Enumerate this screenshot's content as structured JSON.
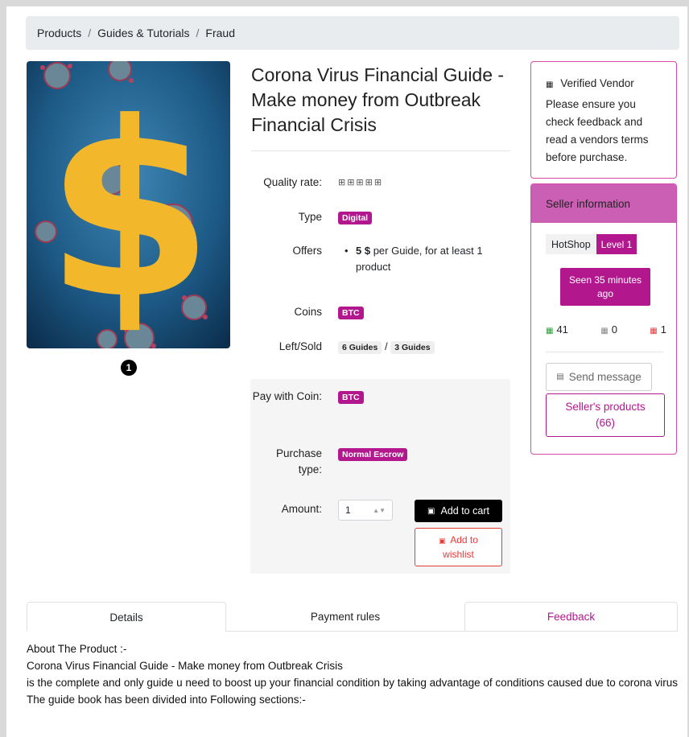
{
  "breadcrumb": {
    "items": [
      "Products",
      "Guides & Tutorials",
      "Fraud"
    ],
    "separator": "/"
  },
  "image": {
    "glyph": "$",
    "indicator": "1"
  },
  "product": {
    "title": "Corona Virus Financial Guide - Make money from Outbreak Financial Crisis",
    "quality_label": "Quality rate:",
    "quality_stars": "⊞⊞⊞⊞⊞",
    "type_label": "Type",
    "type_value": "Digital",
    "offers_label": "Offers",
    "offer_price": "5 $",
    "offer_text": "per Guide, for at least 1 product",
    "coins_label": "Coins",
    "coins_value": "BTC",
    "leftsold_label": "Left/Sold",
    "left_value": "6 Guides",
    "sold_value": "3 Guides",
    "leftsold_sep": "/"
  },
  "purchase": {
    "paywith_label": "Pay with Coin:",
    "paywith_value": "BTC",
    "purchase_type_label": "Purchase type:",
    "purchase_type_value": "Normal Escrow",
    "amount_label": "Amount:",
    "amount_value": "1",
    "add_to_cart": "Add to cart",
    "add_to_wishlist": "Add to wishlist"
  },
  "vendor": {
    "title": "Verified Vendor",
    "text": "Please ensure you check feedback and read a vendors terms before purchase."
  },
  "seller": {
    "header": "Seller information",
    "shop_name": "HotShop",
    "level": "Level 1",
    "seen": "Seen 35 minutes ago",
    "positive": "41",
    "neutral": "0",
    "negative": "1",
    "send_message": "Send message",
    "products": "Seller's products (66)"
  },
  "tabs": {
    "details": "Details",
    "payment": "Payment rules",
    "feedback": "Feedback"
  },
  "description": {
    "line1": "About The Product :-",
    "line2": "Corona Virus Financial Guide - Make money from Outbreak Crisis",
    "line3": "is the complete and only guide u need to boost up your financial condition by taking advantage of conditions caused due to corona virus",
    "line4": "The guide book has been divided into Following sections:-"
  },
  "colors": {
    "accent": "#b3178e",
    "header": "#cb5fb4",
    "danger": "#e23b3b",
    "dollar": "#f2b72b",
    "image_bg": "#1b4f7a"
  },
  "icons": {
    "vendor": "verified-icon",
    "cart": "cart-icon",
    "wishlist": "heart-icon",
    "message": "envelope-icon"
  }
}
